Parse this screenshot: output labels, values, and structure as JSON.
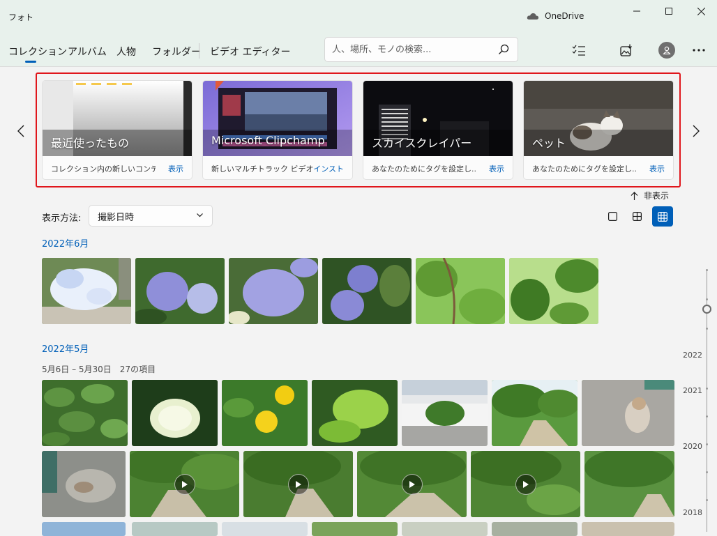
{
  "app": {
    "title": "フォト"
  },
  "titlebar": {
    "onedrive_label": "OneDrive"
  },
  "nav": {
    "tabs": [
      "コレクション",
      "アルバム",
      "人物",
      "フォルダー",
      "ビデオ エディター"
    ],
    "search_placeholder": "人、場所、モノの検索..."
  },
  "featured": [
    {
      "title": "最近使ったもの",
      "desc": "コレクション内の新しいコンテ...",
      "action": "表示"
    },
    {
      "title": "Microsoft Clipchamp",
      "desc": "新しいマルチトラック ビデオ エ...",
      "action": "インスト"
    },
    {
      "title": "スカイスクレイパー",
      "desc": "あなたのためにタグを設定し...",
      "action": "表示"
    },
    {
      "title": "ペット",
      "desc": "あなたのためにタグを設定し...",
      "action": "表示"
    }
  ],
  "hide_label": "非表示",
  "view": {
    "label": "表示方法:",
    "selected": "撮影日時"
  },
  "sections": [
    {
      "title": "2022年6月"
    },
    {
      "title": "2022年5月",
      "subtitle": "5月6日 – 5月30日　27の項目"
    }
  ],
  "timeline": {
    "years": [
      "2022",
      "2021",
      "2020",
      "2018"
    ]
  },
  "colors": {
    "accent": "#005fb8",
    "highlight": "#e0161c"
  },
  "icons": {
    "search": "search-icon",
    "select": "multi-select-icon",
    "import": "import-icon",
    "more": "more-icon",
    "play": "play-icon"
  }
}
